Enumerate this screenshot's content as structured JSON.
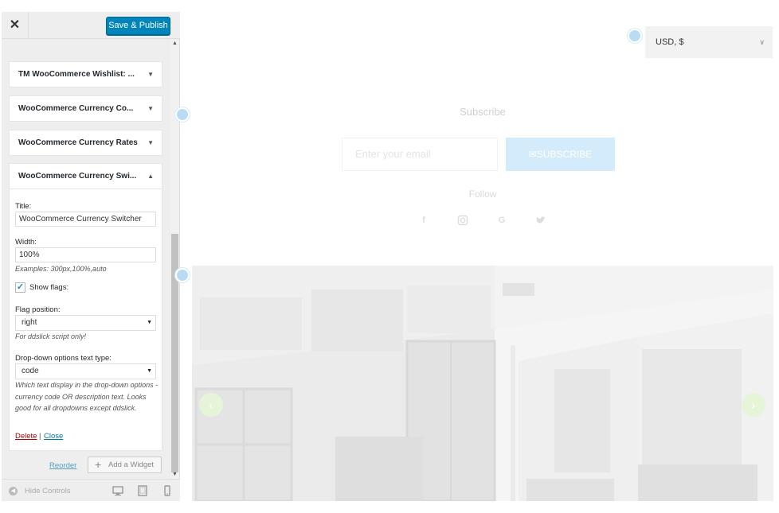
{
  "sidebar": {
    "close_label": "✕",
    "save_label": "Save & Publish",
    "widgets": [
      {
        "title": "TM WooCommerce Wishlist: ...",
        "arrow": "▼"
      },
      {
        "title": "WooCommerce Currency Co...",
        "arrow": "▼"
      },
      {
        "title": "WooCommerce Currency Rates",
        "arrow": "▼"
      }
    ],
    "open_widget": {
      "title": "WooCommerce Currency Swi...",
      "arrow": "▲",
      "title_label": "Title:",
      "title_value": "WooCommerce Currency Switcher",
      "width_label": "Width:",
      "width_value": "100%",
      "width_hint": "Examples: 300px,100%,auto",
      "show_flags_label": "Show flags:",
      "show_flags_checked": true,
      "check_mark": "✓",
      "flag_position_label": "Flag position:",
      "flag_position_value": "right",
      "flag_position_hint": "For ddslick script only!",
      "dropdown_text_label": "Drop-down options text type:",
      "dropdown_text_value": "code",
      "dropdown_text_hint": "Which text display in the drop-down options - currency code OR description text. Looks good for all dropdowns except ddslick.",
      "delete_label": "Delete",
      "separator": "|",
      "close_label": "Close"
    },
    "reorder_label": "Reorder",
    "add_widget_label": "Add a Widget",
    "hide_controls_label": "Hide Controls"
  },
  "preview": {
    "currency_value": "USD, $",
    "subscribe_title": "Subscribe",
    "email_placeholder": "Enter your email",
    "subscribe_button": "SUBSCRIBE",
    "follow_label": "Follow",
    "social_icons": [
      "facebook-icon",
      "instagram-icon",
      "google-icon",
      "twitter-icon"
    ],
    "accent_color": "#0085ba",
    "subscribe_button_color": "#d4ebfb"
  }
}
